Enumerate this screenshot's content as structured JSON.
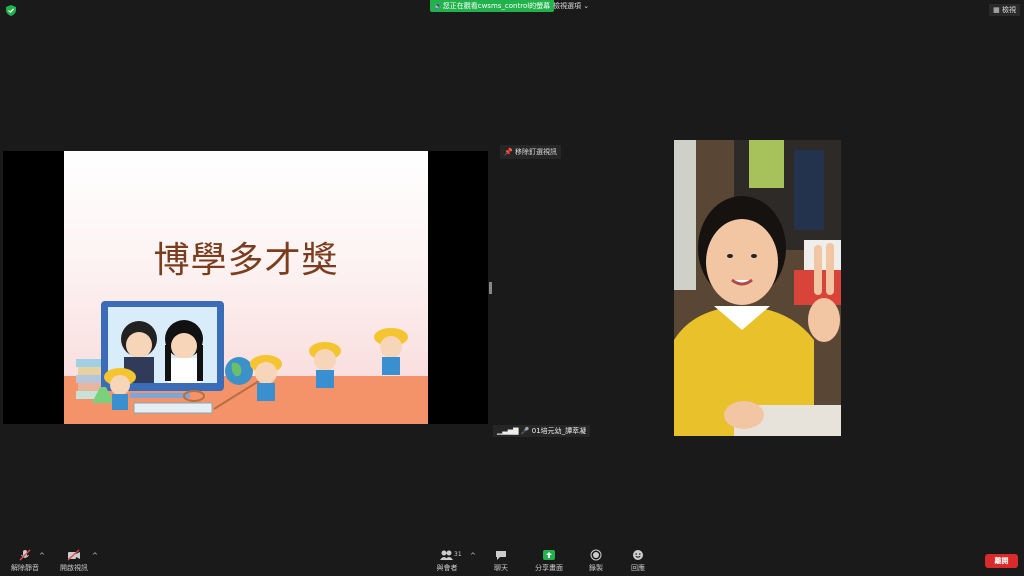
{
  "topbar": {
    "viewing_banner": "您正在觀看cwsms_control的螢幕",
    "view_options": "檢視選項",
    "view_button": "檢視"
  },
  "share": {
    "slide_title": "博學多才獎"
  },
  "video": {
    "unpin_label": "移除釘選視訊",
    "participant_name": "01培元幼_譚萃凝"
  },
  "toolbar": {
    "unmute": "解除靜音",
    "start_video": "開啟視訊",
    "participants": "與會者",
    "participants_count": "31",
    "chat": "聊天",
    "share_screen": "分享畫面",
    "record": "錄製",
    "reactions": "回應",
    "end": "離開"
  },
  "colors": {
    "banner": "#22b24c",
    "end": "#d92b2b",
    "share_icon": "#22b24c"
  }
}
